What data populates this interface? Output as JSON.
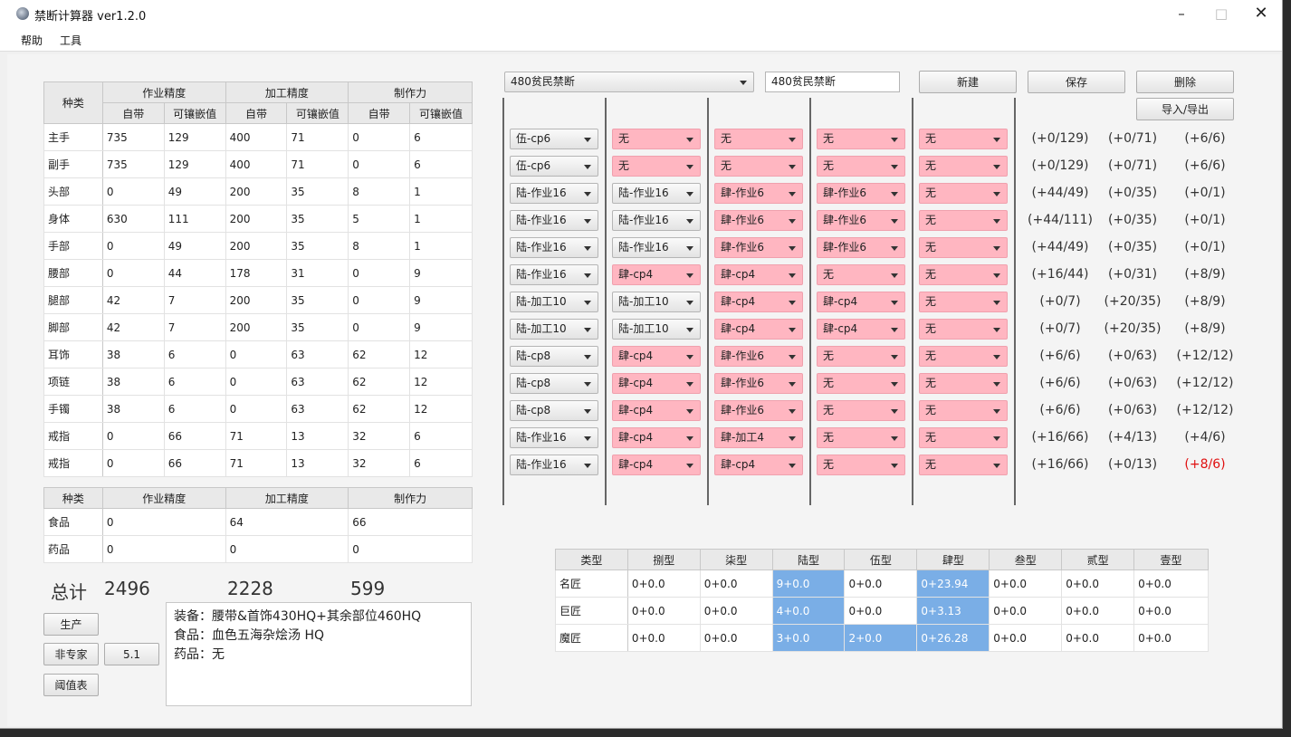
{
  "window": {
    "title": "禁断计算器 ver1.2.0"
  },
  "menu": [
    "帮助",
    "工具"
  ],
  "gear_table": {
    "headers": {
      "kind": "种类",
      "groups": [
        "作业精度",
        "加工精度",
        "制作力"
      ],
      "sub": [
        "自带",
        "可镶嵌值",
        "自带",
        "可镶嵌值",
        "自带",
        "可镶嵌值"
      ]
    },
    "rows": [
      {
        "name": "主手",
        "v": [
          "735",
          "129",
          "400",
          "71",
          "0",
          "6"
        ]
      },
      {
        "name": "副手",
        "v": [
          "735",
          "129",
          "400",
          "71",
          "0",
          "6"
        ]
      },
      {
        "name": "头部",
        "v": [
          "0",
          "49",
          "200",
          "35",
          "8",
          "1"
        ]
      },
      {
        "name": "身体",
        "v": [
          "630",
          "111",
          "200",
          "35",
          "5",
          "1"
        ]
      },
      {
        "name": "手部",
        "v": [
          "0",
          "49",
          "200",
          "35",
          "8",
          "1"
        ]
      },
      {
        "name": "腰部",
        "v": [
          "0",
          "44",
          "178",
          "31",
          "0",
          "9"
        ]
      },
      {
        "name": "腿部",
        "v": [
          "42",
          "7",
          "200",
          "35",
          "0",
          "9"
        ]
      },
      {
        "name": "脚部",
        "v": [
          "42",
          "7",
          "200",
          "35",
          "0",
          "9"
        ]
      },
      {
        "name": "耳饰",
        "v": [
          "38",
          "6",
          "0",
          "63",
          "62",
          "12"
        ]
      },
      {
        "name": "项链",
        "v": [
          "38",
          "6",
          "0",
          "63",
          "62",
          "12"
        ]
      },
      {
        "name": "手镯",
        "v": [
          "38",
          "6",
          "0",
          "63",
          "62",
          "12"
        ]
      },
      {
        "name": "戒指",
        "v": [
          "0",
          "66",
          "71",
          "13",
          "32",
          "6"
        ]
      },
      {
        "name": "戒指",
        "v": [
          "0",
          "66",
          "71",
          "13",
          "32",
          "6"
        ]
      }
    ]
  },
  "food_table": {
    "headers": [
      "种类",
      "作业精度",
      "加工精度",
      "制作力"
    ],
    "rows": [
      {
        "name": "食品",
        "v": [
          "0",
          "64",
          "66"
        ]
      },
      {
        "name": "药品",
        "v": [
          "0",
          "0",
          "0"
        ]
      }
    ]
  },
  "totals": {
    "label": "总计",
    "values": [
      "2496",
      "2228",
      "599"
    ]
  },
  "buttons": {
    "produce": "生产",
    "non_expert": "非专家",
    "version": "5.1",
    "threshold": "阈值表",
    "new": "新建",
    "save": "保存",
    "delete": "删除",
    "import_export": "导入/导出"
  },
  "notes": [
    "装备：腰带&首饰430HQ+其余部位460HQ",
    "食品：血色五海杂烩汤 HQ",
    "药品：无"
  ],
  "preset": {
    "selected": "480贫民禁断",
    "name_input": "480贫民禁断"
  },
  "materia_rows": [
    {
      "slots": [
        "伍-cp6",
        "无",
        "无",
        "无",
        "无"
      ],
      "pink": [
        false,
        true,
        true,
        true,
        true
      ],
      "res": [
        "(+0/129)",
        "(+0/71)",
        "(+6/6)"
      ],
      "red": [
        false,
        false,
        false
      ]
    },
    {
      "slots": [
        "伍-cp6",
        "无",
        "无",
        "无",
        "无"
      ],
      "pink": [
        false,
        true,
        true,
        true,
        true
      ],
      "res": [
        "(+0/129)",
        "(+0/71)",
        "(+6/6)"
      ],
      "red": [
        false,
        false,
        false
      ]
    },
    {
      "slots": [
        "陆-作业16",
        "陆-作业16",
        "肆-作业6",
        "肆-作业6",
        "无"
      ],
      "pink": [
        false,
        false,
        true,
        true,
        true
      ],
      "res": [
        "(+44/49)",
        "(+0/35)",
        "(+0/1)"
      ],
      "red": [
        false,
        false,
        false
      ]
    },
    {
      "slots": [
        "陆-作业16",
        "陆-作业16",
        "肆-作业6",
        "肆-作业6",
        "无"
      ],
      "pink": [
        false,
        false,
        true,
        true,
        true
      ],
      "res": [
        "(+44/111)",
        "(+0/35)",
        "(+0/1)"
      ],
      "red": [
        false,
        false,
        false
      ]
    },
    {
      "slots": [
        "陆-作业16",
        "陆-作业16",
        "肆-作业6",
        "肆-作业6",
        "无"
      ],
      "pink": [
        false,
        false,
        true,
        true,
        true
      ],
      "res": [
        "(+44/49)",
        "(+0/35)",
        "(+0/1)"
      ],
      "red": [
        false,
        false,
        false
      ]
    },
    {
      "slots": [
        "陆-作业16",
        "肆-cp4",
        "肆-cp4",
        "无",
        "无"
      ],
      "pink": [
        false,
        true,
        true,
        true,
        true
      ],
      "res": [
        "(+16/44)",
        "(+0/31)",
        "(+8/9)"
      ],
      "red": [
        false,
        false,
        false
      ]
    },
    {
      "slots": [
        "陆-加工10",
        "陆-加工10",
        "肆-cp4",
        "肆-cp4",
        "无"
      ],
      "pink": [
        false,
        false,
        true,
        true,
        true
      ],
      "res": [
        "(+0/7)",
        "(+20/35)",
        "(+8/9)"
      ],
      "red": [
        false,
        false,
        false
      ]
    },
    {
      "slots": [
        "陆-加工10",
        "陆-加工10",
        "肆-cp4",
        "肆-cp4",
        "无"
      ],
      "pink": [
        false,
        false,
        true,
        true,
        true
      ],
      "res": [
        "(+0/7)",
        "(+20/35)",
        "(+8/9)"
      ],
      "red": [
        false,
        false,
        false
      ]
    },
    {
      "slots": [
        "陆-cp8",
        "肆-cp4",
        "肆-作业6",
        "无",
        "无"
      ],
      "pink": [
        false,
        true,
        true,
        true,
        true
      ],
      "res": [
        "(+6/6)",
        "(+0/63)",
        "(+12/12)"
      ],
      "red": [
        false,
        false,
        false
      ]
    },
    {
      "slots": [
        "陆-cp8",
        "肆-cp4",
        "肆-作业6",
        "无",
        "无"
      ],
      "pink": [
        false,
        true,
        true,
        true,
        true
      ],
      "res": [
        "(+6/6)",
        "(+0/63)",
        "(+12/12)"
      ],
      "red": [
        false,
        false,
        false
      ]
    },
    {
      "slots": [
        "陆-cp8",
        "肆-cp4",
        "肆-作业6",
        "无",
        "无"
      ],
      "pink": [
        false,
        true,
        true,
        true,
        true
      ],
      "res": [
        "(+6/6)",
        "(+0/63)",
        "(+12/12)"
      ],
      "red": [
        false,
        false,
        false
      ]
    },
    {
      "slots": [
        "陆-作业16",
        "肆-cp4",
        "肆-加工4",
        "无",
        "无"
      ],
      "pink": [
        false,
        true,
        true,
        true,
        true
      ],
      "res": [
        "(+16/66)",
        "(+4/13)",
        "(+4/6)"
      ],
      "red": [
        false,
        false,
        false
      ]
    },
    {
      "slots": [
        "陆-作业16",
        "肆-cp4",
        "肆-cp4",
        "无",
        "无"
      ],
      "pink": [
        false,
        true,
        true,
        true,
        true
      ],
      "res": [
        "(+16/66)",
        "(+0/13)",
        "(+8/6)"
      ],
      "red": [
        false,
        false,
        true
      ]
    }
  ],
  "summary_table": {
    "headers": [
      "类型",
      "捌型",
      "柒型",
      "陆型",
      "伍型",
      "肆型",
      "叁型",
      "贰型",
      "壹型"
    ],
    "rows": [
      {
        "name": "名匠",
        "v": [
          "0+0.0",
          "0+0.0",
          "9+0.0",
          "0+0.0",
          "0+23.94",
          "0+0.0",
          "0+0.0",
          "0+0.0"
        ],
        "hl": [
          false,
          false,
          true,
          false,
          true,
          false,
          false,
          false
        ]
      },
      {
        "name": "巨匠",
        "v": [
          "0+0.0",
          "0+0.0",
          "4+0.0",
          "0+0.0",
          "0+3.13",
          "0+0.0",
          "0+0.0",
          "0+0.0"
        ],
        "hl": [
          false,
          false,
          true,
          false,
          true,
          false,
          false,
          false
        ]
      },
      {
        "name": "魔匠",
        "v": [
          "0+0.0",
          "0+0.0",
          "3+0.0",
          "2+0.0",
          "0+26.28",
          "0+0.0",
          "0+0.0",
          "0+0.0"
        ],
        "hl": [
          false,
          false,
          true,
          true,
          true,
          false,
          false,
          false
        ]
      }
    ]
  },
  "colors": {
    "materia_pink": "#ffb6c1",
    "highlight_blue": "#7aaee6",
    "teal_value": "#1e8a8a",
    "navy_value": "#1a2a7a",
    "warn_red": "#e01010"
  }
}
